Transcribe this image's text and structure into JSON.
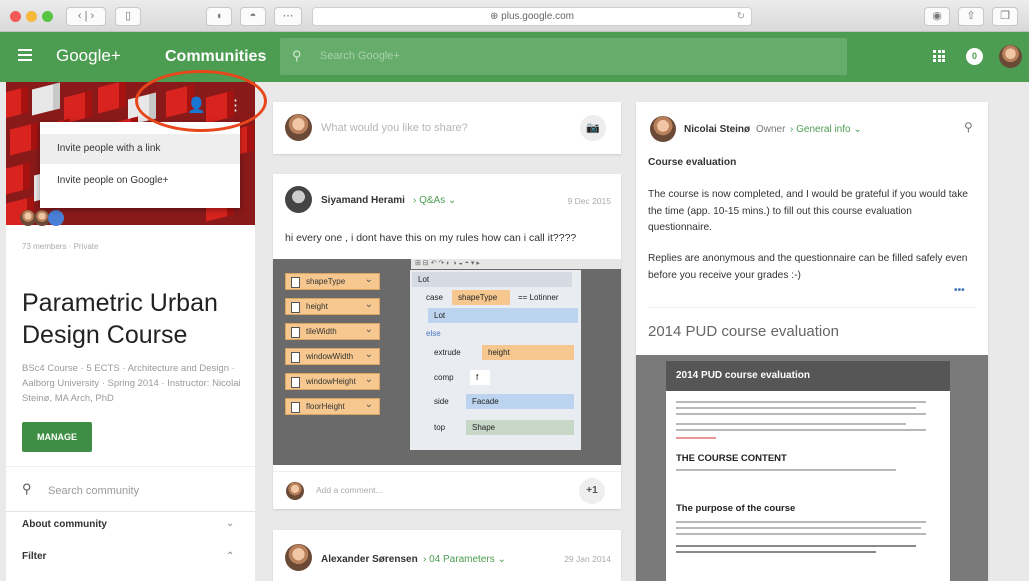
{
  "browser": {
    "url": "⊕ plus.google.com"
  },
  "header": {
    "brand": "Google+",
    "section": "Communities",
    "search_placeholder": "Search Google+",
    "notifications": "0"
  },
  "sidebar": {
    "dropdown_items": [
      "Invite people with a link",
      "Invite people on Google+"
    ],
    "members": "73 members · Private",
    "title": "Parametric Urban Design Course",
    "description": "BSc4 Course · 5 ECTS · Architecture and Design · Aalborg University · Spring 2014 · Instructor: Nicolai Steinø, MA Arch, PhD",
    "manage_label": "MANAGE",
    "search_placeholder": "Search community",
    "about_label": "About community",
    "filter_label": "Filter"
  },
  "share": {
    "placeholder": "What would you like to share?"
  },
  "post1": {
    "author": "Siyamand Herami",
    "category": "› Q&As ⌄",
    "date": "9 Dec 2015",
    "text": "hi every one , i dont have this on my rules how can i call it????",
    "blocks": [
      "shapeType",
      "height",
      "tileWidth",
      "windowWidth",
      "windowHeight",
      "floorHeight"
    ],
    "ws": {
      "lot": "Lot",
      "case": "case",
      "case_block": "shapeType",
      "case_op": "== Lotinner",
      "lot_inner": "Lot",
      "else": "else",
      "extrude": "extrude",
      "extrude_arg": "height",
      "comp": "comp",
      "comp_arg": "f",
      "side": "side",
      "facade": "Facade",
      "top": "top",
      "shape": "Shape"
    },
    "comment_placeholder": "Add a comment...",
    "plus_one": "+1"
  },
  "post2": {
    "author": "Alexander Sørensen",
    "category": "› 04 Parameters ⌄",
    "date": "29 Jan 2014"
  },
  "right": {
    "author": "Nicolai Steinø",
    "role": "Owner",
    "category": "› General info ⌄",
    "heading": "Course evaluation",
    "p1": "The course is now completed, and I would be grateful if you would take the time (app. 10-15 mins.) to fill out this course evaluation questionnaire.",
    "p2": "Replies are anonymous and the questionnaire can be filled safely even before you receive your grades :-)",
    "more": "•••",
    "link_title": "2014 PUD course evaluation",
    "embed_header": "2014 PUD course evaluation",
    "embed_s1": "THE COURSE CONTENT",
    "embed_s2": "The purpose of the course"
  },
  "colors": {
    "brand_green": "#4c9c52",
    "annotation_red": "#e8461b"
  }
}
